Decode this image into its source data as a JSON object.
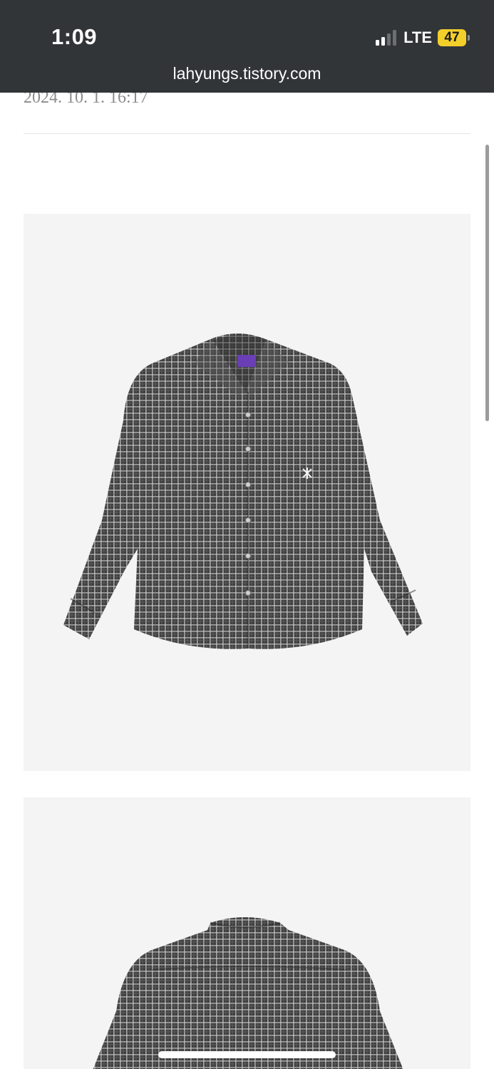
{
  "status_bar": {
    "time": "1:09",
    "network": "LTE",
    "battery": "47",
    "signal_icon": "cellular-signal-icon"
  },
  "browser": {
    "url": "lahyungs.tistory.com"
  },
  "post": {
    "date": "2024. 10. 1. 16:17",
    "images": [
      {
        "name": "shirt-front-photo",
        "label_text": "LABROS",
        "pattern_color": "#4a4a4a"
      },
      {
        "name": "shirt-back-photo",
        "pattern_color": "#4a4a4a"
      }
    ]
  },
  "colors": {
    "topbar": "#323538",
    "photo_bg": "#f4f4f4",
    "brand_label": "#6a3fb5",
    "battery": "#f3cf2a"
  }
}
